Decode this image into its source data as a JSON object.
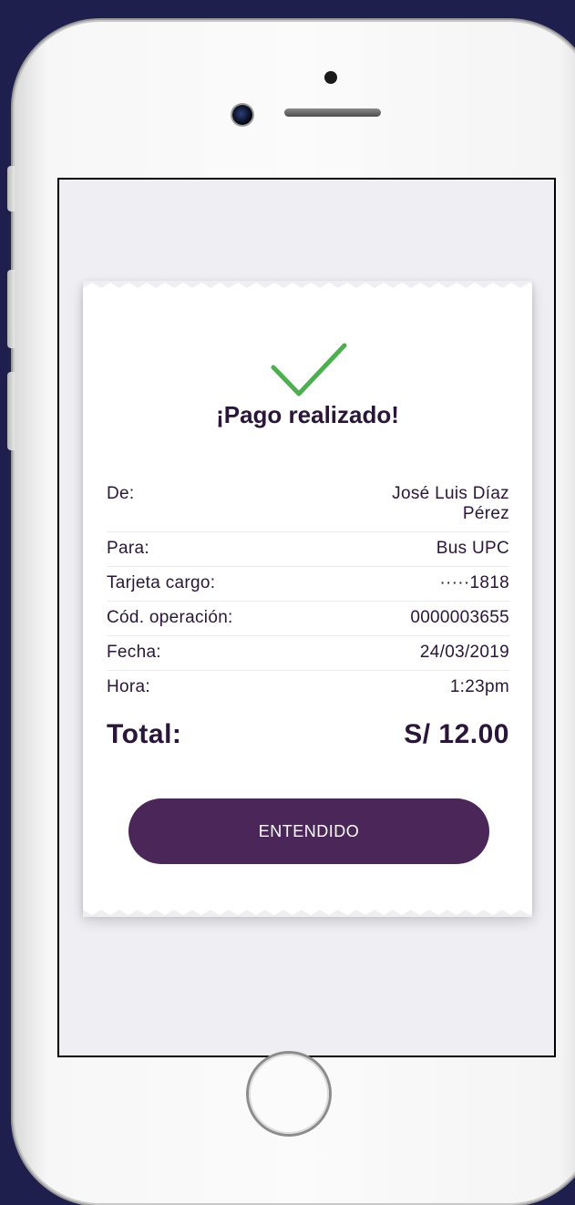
{
  "receipt": {
    "title": "¡Pago realizado!",
    "rows": [
      {
        "label": "De:",
        "value": "José Luis Díaz Pérez"
      },
      {
        "label": "Para:",
        "value": "Bus UPC"
      },
      {
        "label": "Tarjeta cargo:",
        "value": "·····1818"
      },
      {
        "label": "Cód. operación:",
        "value": "0000003655"
      },
      {
        "label": "Fecha:",
        "value": "24/03/2019"
      },
      {
        "label": "Hora:",
        "value": "1:23pm"
      }
    ],
    "total_label": "Total:",
    "total_value": "S/ 12.00",
    "button_label": "ENTENDIDO"
  },
  "icons": {
    "success": "checkmark-icon"
  },
  "colors": {
    "background": "#1f1f4e",
    "accent": "#4b2659",
    "success": "#4caf50",
    "text": "#2a1638",
    "screen": "#efeff3"
  }
}
